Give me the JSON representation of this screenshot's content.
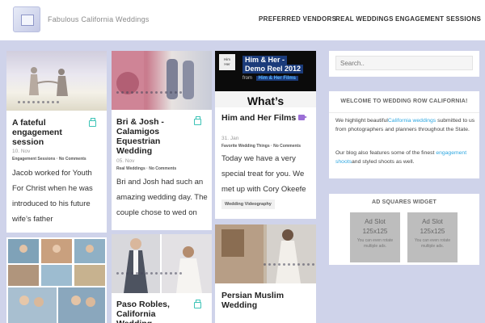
{
  "site": {
    "title": "Fabulous California Weddings"
  },
  "nav": [
    {
      "label": "PREFERRED VENDORS"
    },
    {
      "label": "REAL WEDDINGS"
    },
    {
      "label": "ENGAGEMENT SESSIONS"
    }
  ],
  "posts": [
    {
      "title": "A fateful engagement session",
      "date": "10. Nov",
      "meta": [
        "Engagement Sessions",
        "No Comments"
      ],
      "excerpt": "Jacob worked for Youth For Christ when he was introduced to his future wife’s father"
    },
    {
      "title": "Bri & Josh - Calamigos Equestrian Wedding",
      "date": "05. Nov",
      "meta": [
        "Real Weddings",
        "No Comments"
      ],
      "excerpt": "Bri and Josh had such an amazing wedding day. The couple chose to wed on"
    },
    {
      "title": "Him and Her Films",
      "date": "31. Jan",
      "meta": [
        "Favorite Wedding Things",
        "No Comments"
      ],
      "excerpt": "Today we have a very special treat for you.  We met up with Cory Okeefe",
      "tag": "Wedding Videography",
      "video": {
        "line1": "Him & Her -",
        "line2": "Demo Reel 2012",
        "from_label": "from",
        "from_name": "Him & Her Films",
        "overlay": "What’s",
        "logo_top": "Him",
        "logo_bottom": "Her"
      }
    },
    {
      "title": "Paso Robles, California Wedding"
    },
    {
      "title": "Persian Muslim Wedding"
    }
  ],
  "sidebar": {
    "search_placeholder": "Search..",
    "welcome": {
      "title": "WELCOME TO WEDDING ROW CALIFORNIA!",
      "p1_a": "We highlight beautiful",
      "p1_link": "California weddings",
      "p1_b": " submitted to us from photographers and planners throughout the State.",
      "p2_a": "Our blog also features some of the finest ",
      "p2_link": "engagement shoots",
      "p2_b": "and styled shoots as well."
    },
    "ads": {
      "title": "AD SQUARES WIDGET",
      "slots": [
        {
          "name": "Ad Slot",
          "size": "125x125",
          "note": "You can even rotate multiple ads."
        },
        {
          "name": "Ad Slot",
          "size": "125x125",
          "note": "You can even rotate multiple ads."
        }
      ]
    }
  },
  "colors": {
    "background": "#cfd3ea",
    "accent_link": "#2fa7e0",
    "standard_icon": "#3cc3b6",
    "video_icon": "#9b6fd6"
  }
}
